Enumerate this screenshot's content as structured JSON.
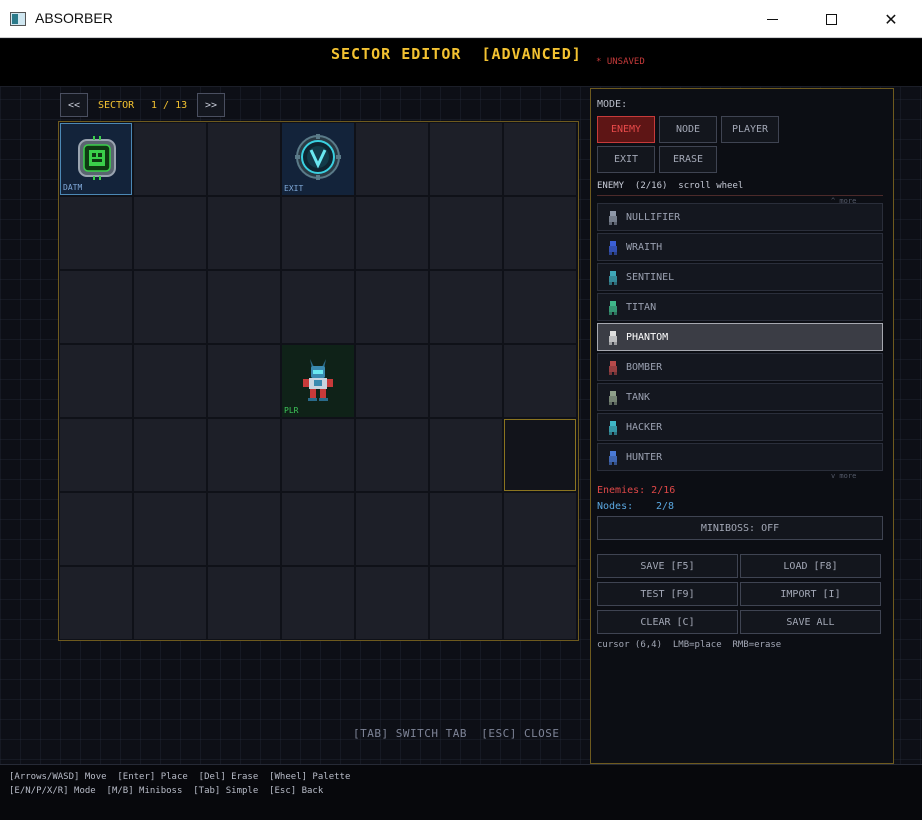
{
  "window": {
    "title": "ABSORBER"
  },
  "header": {
    "title": "SECTOR EDITOR  [ADVANCED]",
    "unsaved": "* UNSAVED"
  },
  "sector_nav": {
    "prev": "<<",
    "label": "SECTOR",
    "count": "1 / 13",
    "next": ">>"
  },
  "grid": {
    "cols": 7,
    "rows": 7,
    "cells": [
      {
        "col": 0,
        "row": 0,
        "type": "datum",
        "tag": "DATM"
      },
      {
        "col": 3,
        "row": 0,
        "type": "exit",
        "tag": "EXIT"
      },
      {
        "col": 3,
        "row": 3,
        "type": "player",
        "tag": "PLR"
      }
    ],
    "cursor": {
      "col": 6,
      "row": 4
    }
  },
  "bottom_hint": "[TAB] SWITCH TAB  [ESC] CLOSE",
  "panel": {
    "mode_label": "MODE:",
    "modes": [
      {
        "label": "ENEMY",
        "active": true
      },
      {
        "label": "NODE",
        "active": false
      },
      {
        "label": "PLAYER",
        "active": false
      },
      {
        "label": "EXIT",
        "active": false
      },
      {
        "label": "ERASE",
        "active": false
      }
    ],
    "enemy_info": "ENEMY  (2/16)  scroll wheel",
    "more_up": "^ more",
    "more_down": "v more",
    "enemies": [
      {
        "name": "NULLIFIER",
        "color": "#8f98a8",
        "selected": false
      },
      {
        "name": "WRAITH",
        "color": "#3b5fd6",
        "selected": false
      },
      {
        "name": "SENTINEL",
        "color": "#3fa7b8",
        "selected": false
      },
      {
        "name": "TITAN",
        "color": "#3fb88a",
        "selected": false
      },
      {
        "name": "PHANTOM",
        "color": "#e0e0e0",
        "selected": true
      },
      {
        "name": "BOMBER",
        "color": "#b84a4a",
        "selected": false
      },
      {
        "name": "TANK",
        "color": "#8fa08a",
        "selected": false
      },
      {
        "name": "HACKER",
        "color": "#3fb8c8",
        "selected": false
      },
      {
        "name": "HUNTER",
        "color": "#4a7ad6",
        "selected": false
      }
    ],
    "stats": {
      "enemies": "Enemies: 2/16",
      "nodes_label": "Nodes:",
      "nodes_value": "2/8"
    },
    "miniboss": "MINIBOSS: OFF",
    "actions": {
      "save": "SAVE [F5]",
      "load": "LOAD [F8]",
      "test": "TEST [F9]",
      "import": "IMPORT [I]",
      "clear": "CLEAR [C]",
      "save_all": "SAVE ALL"
    },
    "cursor_info": "cursor (6,4)  LMB=place  RMB=erase"
  },
  "footer": {
    "line1": "[Arrows/WASD] Move  [Enter] Place  [Del] Erase  [Wheel] Palette",
    "line2": "[E/N/P/X/R] Mode  [M/B] Miniboss  [Tab] Simple  [Esc] Back"
  },
  "colors": {
    "accent_gold": "#f3c231",
    "active_red": "#e84a4a",
    "node_blue": "#5aa7e0"
  }
}
